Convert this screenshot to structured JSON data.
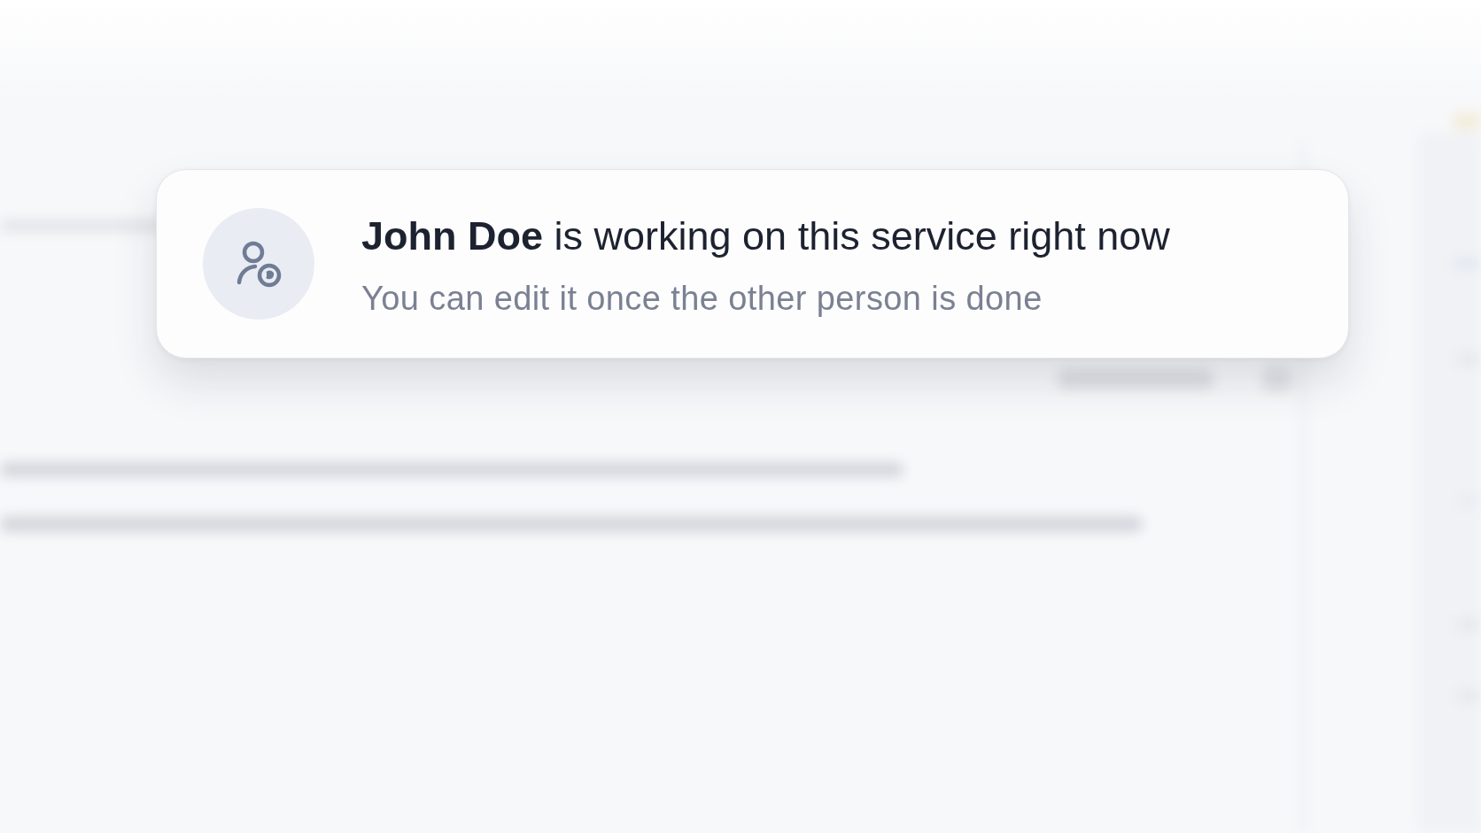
{
  "notification": {
    "title": "**John Doe** is working on this service right now",
    "message": "You can edit it once the other person is done"
  }
}
